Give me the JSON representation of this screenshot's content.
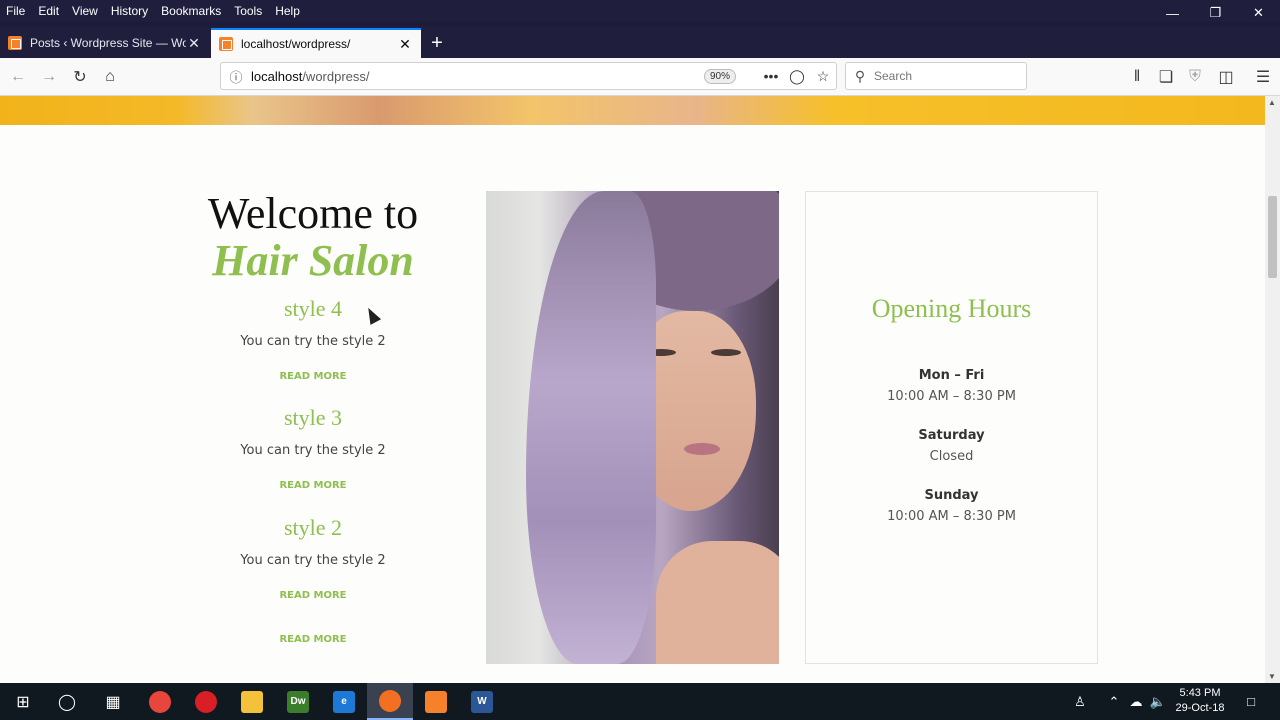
{
  "menubar": {
    "items": [
      "File",
      "Edit",
      "View",
      "History",
      "Bookmarks",
      "Tools",
      "Help"
    ]
  },
  "window_controls": {
    "minimize": "—",
    "restore": "❐",
    "close": "✕"
  },
  "tabs": [
    {
      "label": "Posts ‹ Wordpress Site — Word",
      "close": "✕"
    },
    {
      "label": "localhost/wordpress/",
      "close": "✕"
    }
  ],
  "newtab_symbol": "+",
  "nav": {
    "url_host": "localhost",
    "url_path": "/wordpress/",
    "zoom": "90%",
    "search_placeholder": "Search"
  },
  "page": {
    "welcome_line1": "Welcome to",
    "welcome_line2": "Hair Salon",
    "posts": [
      {
        "title": "style 4",
        "excerpt": "You can try the style 2",
        "more": "READ MORE"
      },
      {
        "title": "style 3",
        "excerpt": "You can try the style 2",
        "more": "READ MORE"
      },
      {
        "title": "style 2",
        "excerpt": "You can try the style 2",
        "more": "READ MORE"
      }
    ],
    "extra_read_more": "READ MORE",
    "hours": {
      "title": "Opening Hours",
      "rows": [
        {
          "day": "Mon – Fri",
          "time": "10:00 AM – 8:30 PM"
        },
        {
          "day": "Saturday",
          "time": "Closed"
        },
        {
          "day": "Sunday",
          "time": "10:00 AM – 8:30 PM"
        }
      ]
    }
  },
  "taskbar": {
    "time": "5:43 PM",
    "date": "29-Oct-18",
    "apps": [
      {
        "name": "chrome",
        "label": "",
        "color": "#e8453c"
      },
      {
        "name": "opera",
        "label": "",
        "color": "#d81f26"
      },
      {
        "name": "file-explorer",
        "label": "",
        "color": "#f3c13a"
      },
      {
        "name": "dreamweaver",
        "label": "Dw",
        "color": "#3a7d2c"
      },
      {
        "name": "edge",
        "label": "e",
        "color": "#1e78d6"
      },
      {
        "name": "firefox",
        "label": "",
        "color": "#f36f21"
      },
      {
        "name": "xampp",
        "label": "",
        "color": "#f5822a"
      },
      {
        "name": "word",
        "label": "W",
        "color": "#2b5797"
      }
    ]
  },
  "colors": {
    "accent": "#8ebf4f",
    "tab_highlight": "#0a84ff"
  }
}
